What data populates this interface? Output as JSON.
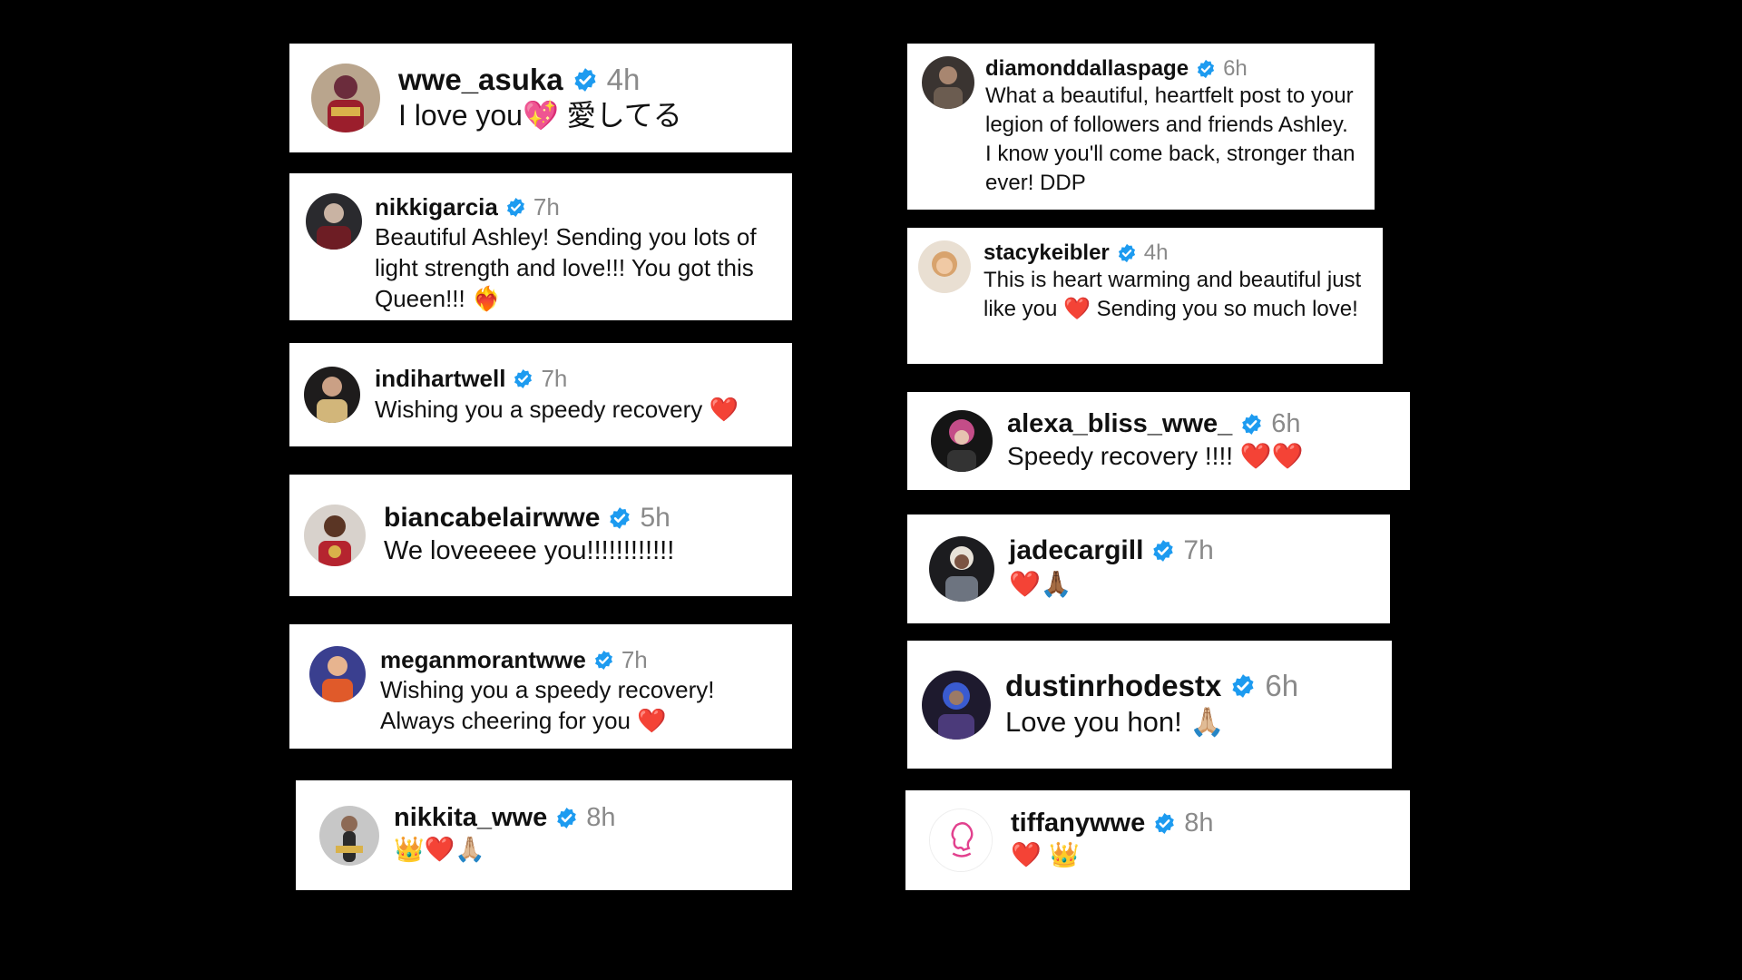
{
  "colors": {
    "background": "#000000",
    "card": "#ffffff",
    "verified": "#1d9bf0",
    "timestamp": "#8a8a8a",
    "heart": "#e0212b"
  },
  "comments": [
    {
      "username": "wwe_asuka",
      "time": "4h",
      "text": "I love you💖 愛してる",
      "verified_icon": "verified-badge-icon"
    },
    {
      "username": "nikkigarcia",
      "time": "7h",
      "text": "Beautiful Ashley! Sending you lots of light strength and love!!! You got this Queen!!! ❤️‍🔥",
      "verified_icon": "verified-badge-icon"
    },
    {
      "username": "indihartwell",
      "time": "7h",
      "text": "Wishing you a speedy recovery ❤️",
      "verified_icon": "verified-badge-icon"
    },
    {
      "username": "biancabelairwwe",
      "time": "5h",
      "text": "We loveeeee you!!!!!!!!!!!!",
      "verified_icon": "verified-badge-icon"
    },
    {
      "username": "meganmorantwwe",
      "time": "7h",
      "text": "Wishing you a speedy recovery! Always cheering for you ❤️",
      "verified_icon": "verified-badge-icon"
    },
    {
      "username": "nikkita_wwe",
      "time": "8h",
      "text": "👑❤️🙏🏼",
      "verified_icon": "verified-badge-icon"
    },
    {
      "username": "diamonddallaspage",
      "time": "6h",
      "text": "What a beautiful, heartfelt post to your legion of followers and friends Ashley. I know you'll come back, stronger than ever! DDP",
      "verified_icon": "verified-badge-icon"
    },
    {
      "username": "stacykeibler",
      "time": "4h",
      "text": "This is heart warming and beautiful just like you ❤️ Sending you so much love!",
      "verified_icon": "verified-badge-icon"
    },
    {
      "username": "alexa_bliss_wwe_",
      "time": "6h",
      "text": "Speedy recovery !!!! ❤️❤️",
      "verified_icon": "verified-badge-icon"
    },
    {
      "username": "jadecargill",
      "time": "7h",
      "text": "❤️🙏🏾",
      "verified_icon": "verified-badge-icon"
    },
    {
      "username": "dustinrhodestx",
      "time": "6h",
      "text": "Love you hon! 🙏🏼",
      "verified_icon": "verified-badge-icon"
    },
    {
      "username": "tiffanywwe",
      "time": "8h",
      "text": "❤️ 👑",
      "verified_icon": "verified-badge-icon"
    }
  ]
}
